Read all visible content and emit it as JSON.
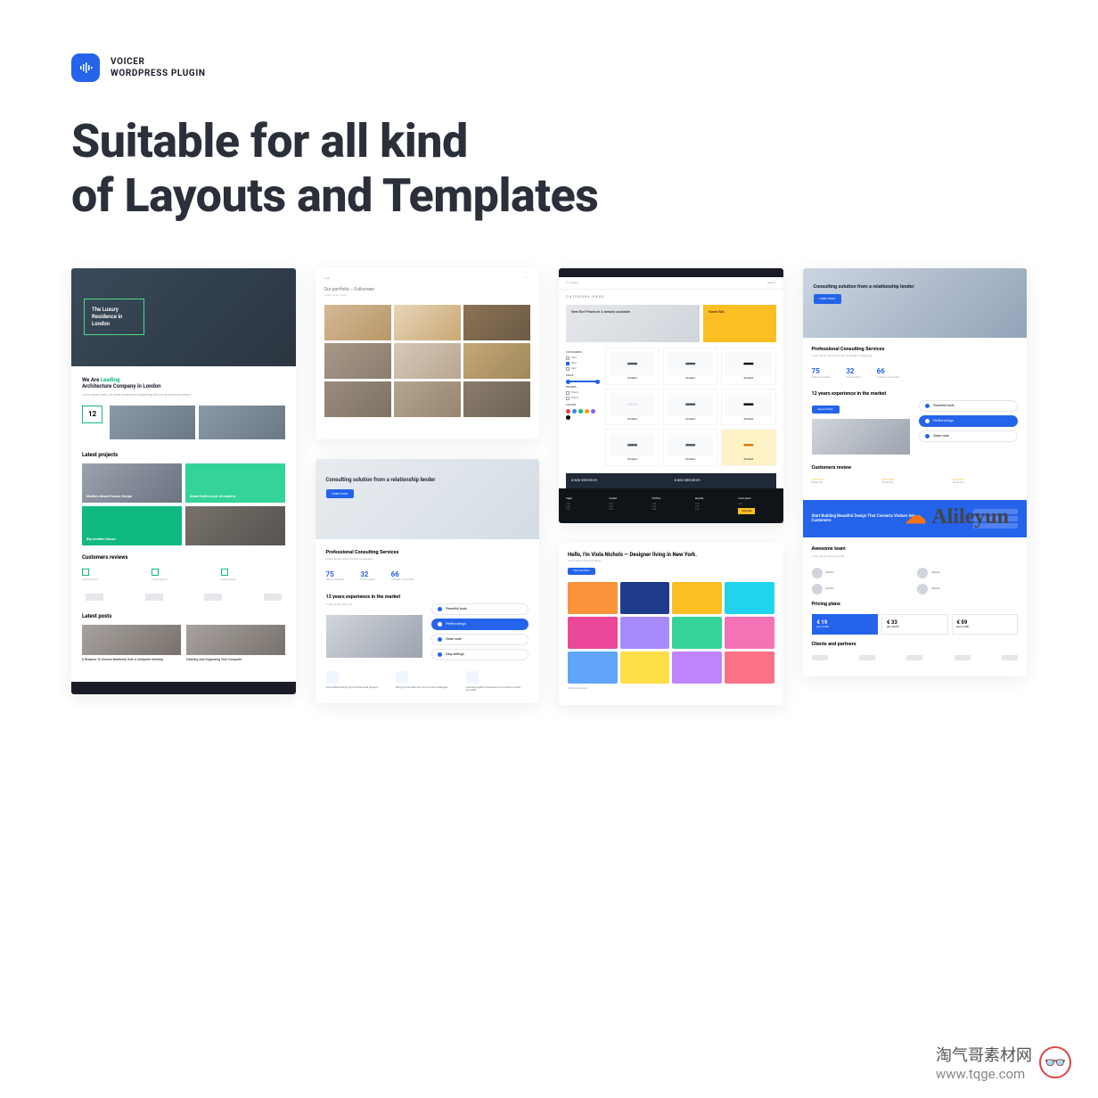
{
  "brand": {
    "name": "VOICER",
    "tagline": "WORDPRESS PLUGIN"
  },
  "headline_l1": "Suitable for all kind",
  "headline_l2": "of Layouts and Templates",
  "thumbs": {
    "arch": {
      "hero_title": "The Luxury Residence in London",
      "intro_1": "We Are ",
      "intro_2": "Leading",
      "intro_3": "Architecture Company in London",
      "stat": "12",
      "sec_projects": "Latest projects",
      "proj": [
        "Modern desert house design",
        "Green leaf as part of modern",
        "",
        "Big modern house"
      ],
      "sec_reviews": "Customers reviews",
      "sec_posts": "Latest posts",
      "posts": [
        "8 Reasons To Choose Notebook Over A Computer Desktop",
        "Cleaning And Organizing Your Computer"
      ]
    },
    "portfolio": {
      "title": "Our portfolio – Fullscreen"
    },
    "consulting": {
      "hero": "Consulting solution from a relationship lender",
      "btn": "Learn more",
      "h1": "Professional Consulting Services",
      "stats": [
        {
          "n": "75",
          "l": "Orders received"
        },
        {
          "n": "32",
          "l": "Hours spent"
        },
        {
          "n": "66",
          "l": "Coffees consumed"
        }
      ],
      "h2": "12 years experience in the market",
      "pills": [
        "Powerfull tools",
        "Perfect design",
        "Clean code",
        "Easy settings"
      ],
      "features": [
        "Automated testing and professional support",
        "Bring to the table win-win survival strategies",
        "Leverage agile frameworks to provide a robust synopsis"
      ]
    },
    "shop": {
      "crumb": "CATEGORY PAGE",
      "banner1": "New Bot Phantom 4 already available",
      "banner2": "Konst MX",
      "side_h": [
        "CATEGORIES",
        "PRICE",
        "BRANDS",
        "COLORS"
      ],
      "phone": "8 800 555-05-09",
      "foot_cols": [
        "Pages",
        "Content",
        "Portfolio",
        "Recently",
        "Lorem ipsum"
      ]
    },
    "designer": {
      "h": "Hello, I'm Viola Nichols — Designer living in New York.",
      "btn": "View portfolio",
      "label": "California poster"
    },
    "full": {
      "hero": "Consulting solution from a relationship lender",
      "h1": "Professional Consulting Services",
      "h2": "12 years experience in the market",
      "h3": "Customers review",
      "cta": "Start Building Beautiful Design That Converts Visitors Into Customers",
      "h4": "Awesome team",
      "h5": "Pricing plans",
      "prices": [
        "€ 19",
        "€ 33",
        "€ 59"
      ],
      "h6": "Clients and partners"
    }
  },
  "watermarks": {
    "alileyun": "Alileyun",
    "cn": "淘气哥素材网",
    "url": "www.tqge.com"
  }
}
